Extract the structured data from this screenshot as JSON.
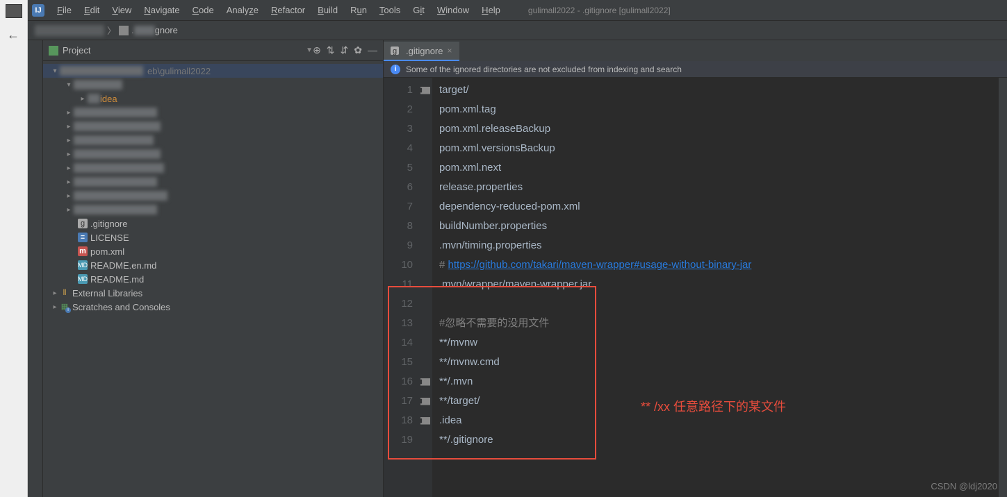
{
  "menu": {
    "items": [
      "File",
      "Edit",
      "View",
      "Navigate",
      "Code",
      "Analyze",
      "Refactor",
      "Build",
      "Run",
      "Tools",
      "Git",
      "Window",
      "Help"
    ],
    "title": "gulimall2022 - .gitignore [gulimall2022]"
  },
  "breadcrumb": {
    "suffix": "gnore"
  },
  "project": {
    "label": "Project",
    "root_suffix": "eb\\gulimall2022",
    "idea_folder": "idea",
    "files": [
      ".gitignore",
      "LICENSE",
      "pom.xml",
      "README.en.md",
      "README.md"
    ],
    "ext_lib": "External Libraries",
    "scratches": "Scratches and Consoles"
  },
  "tab": {
    "name": ".gitignore"
  },
  "notification": "Some of the ignored directories are not excluded from indexing and search",
  "editor": {
    "lines": [
      {
        "n": "1",
        "fold": true,
        "t": "target/"
      },
      {
        "n": "2",
        "t": "pom.xml.tag"
      },
      {
        "n": "3",
        "t": "pom.xml.releaseBackup"
      },
      {
        "n": "4",
        "t": "pom.xml.versionsBackup"
      },
      {
        "n": "5",
        "t": "pom.xml.next"
      },
      {
        "n": "6",
        "t": "release.properties"
      },
      {
        "n": "7",
        "t": "dependency-reduced-pom.xml"
      },
      {
        "n": "8",
        "t": "buildNumber.properties"
      },
      {
        "n": "9",
        "t": ".mvn/timing.properties"
      },
      {
        "n": "10",
        "comment": true,
        "pre": "# ",
        "link": "https://github.com/takari/maven-wrapper#usage-without-binary-jar"
      },
      {
        "n": "11",
        "t": ".mvn/wrapper/maven-wrapper.jar"
      },
      {
        "n": "12",
        "t": ""
      },
      {
        "n": "13",
        "comment": true,
        "t": "#忽略不需要的没用文件"
      },
      {
        "n": "14",
        "t": "**/mvnw"
      },
      {
        "n": "15",
        "t": "**/mvnw.cmd"
      },
      {
        "n": "16",
        "fold": true,
        "t": "**/.mvn"
      },
      {
        "n": "17",
        "fold": true,
        "t": "**/target/"
      },
      {
        "n": "18",
        "fold": true,
        "t": ".idea"
      },
      {
        "n": "19",
        "t": "**/.gitignore"
      }
    ]
  },
  "annotation": "** /xx 任意路径下的某文件",
  "watermark": "CSDN @ldj2020"
}
